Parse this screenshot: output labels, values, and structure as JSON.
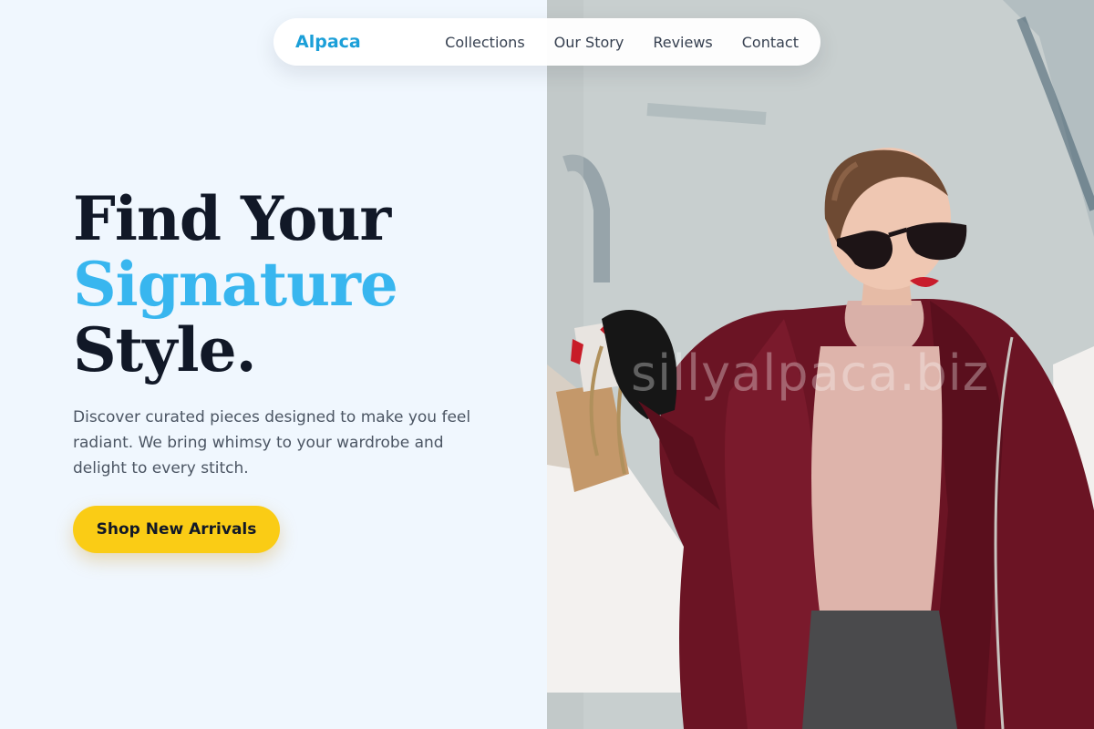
{
  "nav": {
    "brand": "Alpaca",
    "links": [
      "Collections",
      "Our Story",
      "Reviews",
      "Contact"
    ]
  },
  "hero": {
    "title_line1": "Find Your",
    "title_line2": "Signature",
    "title_line3": "Style.",
    "description": "Discover curated pieces designed to make you feel radiant. We bring whimsy to your wardrobe and delight to every stitch.",
    "cta_label": "Shop New Arrivals"
  },
  "image": {
    "watermark": "sillyalpaca.biz",
    "subject": "woman in burgundy coat and sunglasses holding shopping bags"
  },
  "colors": {
    "background": "#f0f7fe",
    "brand": "#1b9fd8",
    "accent": "#38b6ef",
    "cta": "#facc15",
    "heading": "#111827"
  }
}
